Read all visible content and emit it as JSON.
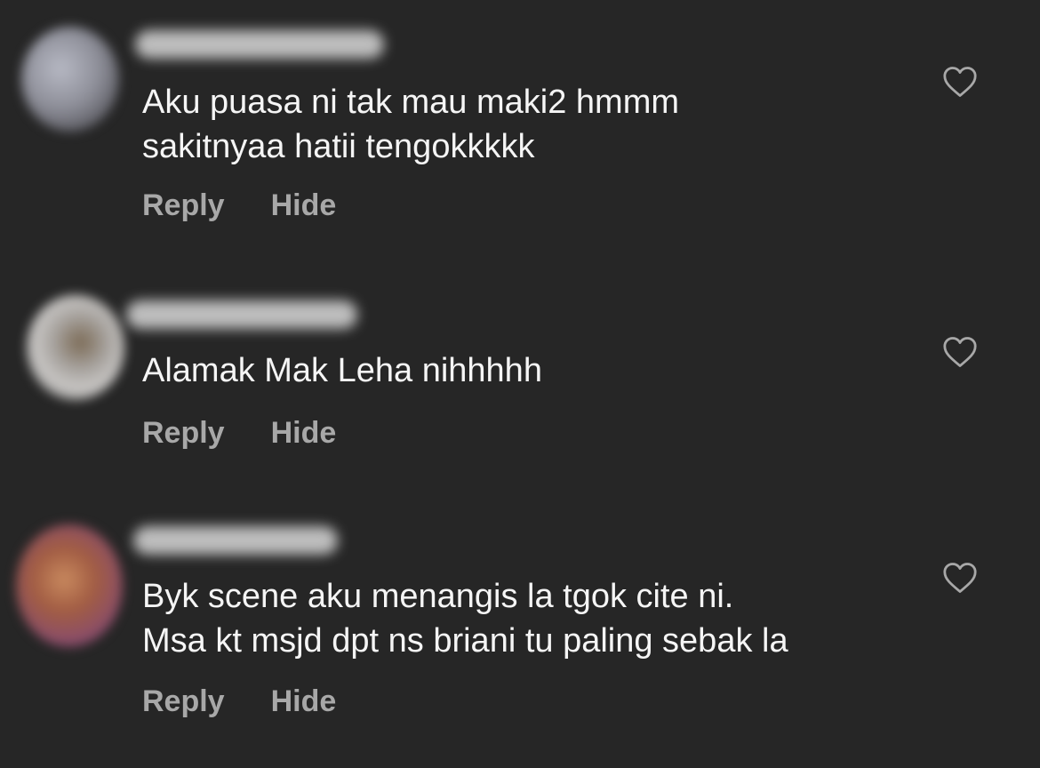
{
  "comments": [
    {
      "text": "Aku puasa ni tak mau maki2 hmmm\nsakitnyaa hatii tengokkkkk",
      "actions": {
        "reply": "Reply",
        "hide": "Hide"
      }
    },
    {
      "text": "Alamak Mak Leha nihhhhh",
      "actions": {
        "reply": "Reply",
        "hide": "Hide"
      }
    },
    {
      "text": "Byk scene aku menangis la tgok cite ni.\nMsa kt msjd dpt ns briani tu paling sebak la",
      "actions": {
        "reply": "Reply",
        "hide": "Hide"
      }
    }
  ],
  "icons": {
    "like": "heart-outline-icon"
  },
  "colors": {
    "background": "#262626",
    "text": "#f5f5f5",
    "secondary_text": "#a8a8a8"
  }
}
